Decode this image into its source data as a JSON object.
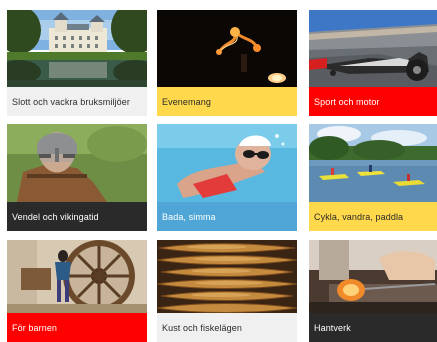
{
  "tiles": [
    {
      "label": "Slott och vackra bruksmiljöer",
      "caption_color": "#f0f0f0",
      "image": "castle-by-lake-image"
    },
    {
      "label": "Evenemang",
      "caption_color": "#ffd84c",
      "image": "fire-juggling-night-image"
    },
    {
      "label": "Sport och motor",
      "caption_color": "#ff0000",
      "image": "dragster-race-image"
    },
    {
      "label": "Vendel och vikingatid",
      "caption_color": "#2a2a2a",
      "image": "viking-helmet-man-image"
    },
    {
      "label": "Bada, simma",
      "caption_color": "#4fa6d6",
      "image": "swimmer-underwater-image"
    },
    {
      "label": "Cykla, vandra, paddla",
      "caption_color": "#ffd84c",
      "image": "kayaks-on-lake-image"
    },
    {
      "label": "För barnen",
      "caption_color": "#ff0000",
      "image": "child-by-mill-wheel-image"
    },
    {
      "label": "Kust och fiskelägen",
      "caption_color": "#f0f0f0",
      "image": "smoked-herring-image"
    },
    {
      "label": "Hantverk",
      "caption_color": "#2a2a2a",
      "image": "glassblowing-image"
    }
  ]
}
